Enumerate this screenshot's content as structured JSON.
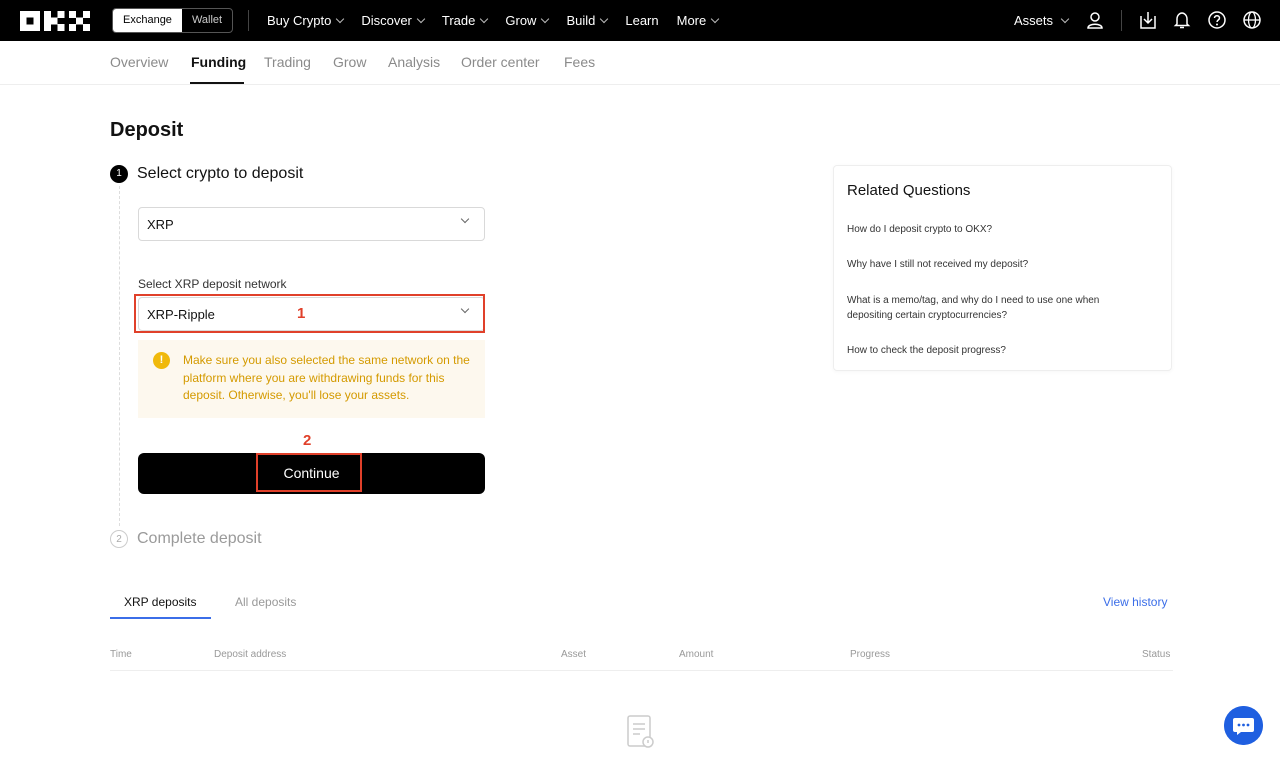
{
  "topbar": {
    "logo_text": "OKX",
    "segment": [
      "Exchange",
      "Wallet"
    ],
    "nav": [
      "Buy Crypto",
      "Discover",
      "Trade",
      "Grow",
      "Build",
      "Learn",
      "More"
    ],
    "assets": "Assets"
  },
  "subnav": [
    "Overview",
    "Funding",
    "Trading",
    "Grow",
    "Analysis",
    "Order center",
    "Fees"
  ],
  "page": {
    "title": "Deposit",
    "step1_label": "Select crypto to deposit",
    "step1_num": "1",
    "crypto_value": "XRP",
    "network_label": "Select XRP deposit network",
    "network_value": "XRP-Ripple",
    "warning": "Make sure you also selected the same network on the platform where you are withdrawing funds for this deposit. Otherwise, you'll lose your assets.",
    "continue_label": "Continue",
    "step2_num": "2",
    "step2_label": "Complete deposit",
    "annotation_1": "1",
    "annotation_2": "2"
  },
  "related": {
    "title": "Related Questions",
    "questions": [
      "How do I deposit crypto to OKX?",
      "Why have I still not received my deposit?",
      "What is a memo/tag, and why do I need to use one when depositing certain cryptocurrencies?",
      "How to check the deposit progress?"
    ]
  },
  "history": {
    "tabs": [
      "XRP deposits",
      "All deposits"
    ],
    "view_history": "View history",
    "columns": [
      "Time",
      "Deposit address",
      "Asset",
      "Amount",
      "Progress",
      "Status"
    ]
  },
  "colors": {
    "accent": "#3b6ee8",
    "warning": "#d49a00",
    "annotation": "#e0402a"
  }
}
